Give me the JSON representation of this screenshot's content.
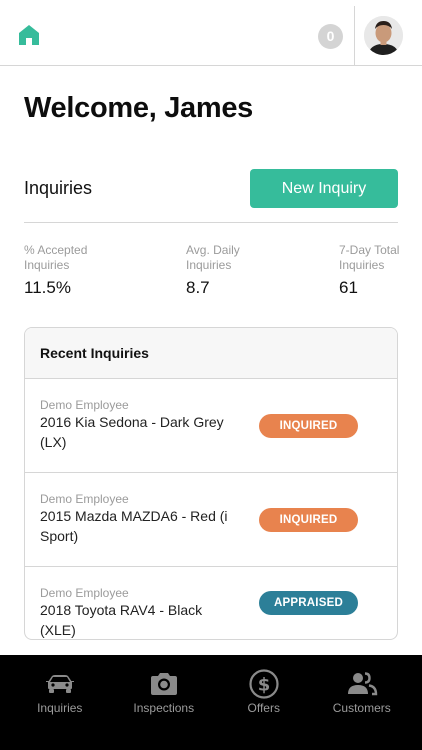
{
  "header": {
    "notification_count": "0",
    "accent_color": "#36bc9b"
  },
  "welcome": "Welcome, James",
  "inquiries_section": {
    "title": "Inquiries",
    "new_button": "New Inquiry"
  },
  "stats": [
    {
      "label": "% Accepted\nInquiries",
      "value": "11.5%"
    },
    {
      "label": "Avg. Daily\nInquiries",
      "value": "8.7"
    },
    {
      "label": "7-Day Total\nInquiries",
      "value": "61"
    }
  ],
  "recent": {
    "title": "Recent Inquiries",
    "items": [
      {
        "employee": "Demo Employee",
        "vehicle": "2016 Kia Sedona - Dark Grey (LX)",
        "status": "INQUIRED",
        "status_color": "#e8834e"
      },
      {
        "employee": "Demo Employee",
        "vehicle": "2015 Mazda MAZDA6 - Red (i Sport)",
        "status": "INQUIRED",
        "status_color": "#e8834e"
      },
      {
        "employee": "Demo Employee",
        "vehicle": "2018 Toyota RAV4 - Black (XLE)",
        "status": "APPRAISED",
        "status_color": "#2c7f98"
      }
    ]
  },
  "tabs": [
    {
      "label": "Inquiries",
      "icon": "car-icon"
    },
    {
      "label": "Inspections",
      "icon": "camera-icon"
    },
    {
      "label": "Offers",
      "icon": "dollar-icon"
    },
    {
      "label": "Customers",
      "icon": "users-icon"
    }
  ]
}
